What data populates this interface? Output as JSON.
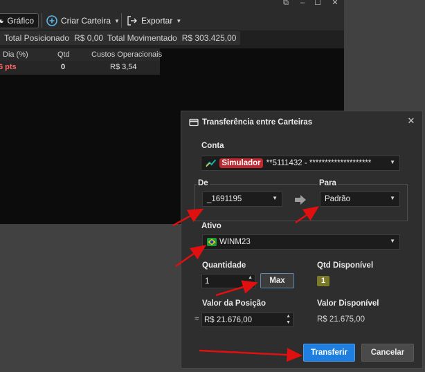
{
  "window": {
    "controls": [
      "⧉",
      "–",
      "☐",
      "✕"
    ]
  },
  "toolbar": {
    "chart_label": "Gráfico",
    "create_wallet_label": "Criar Carteira",
    "export_label": "Exportar"
  },
  "stats": {
    "total_posicionado_label": "Total Posicionado",
    "total_posicionado_value": "R$ 0,00",
    "total_movimentado_label": "Total Movimentado",
    "total_movimentado_value": "R$ 303.425,00"
  },
  "table": {
    "columns": [
      "Dia (%)",
      "Qtd",
      "Custos Operacionais"
    ],
    "row": {
      "dia": "6 pts",
      "qtd": "0",
      "custos": "R$ 3,54"
    }
  },
  "dialog": {
    "title": "Transferência entre Carteiras",
    "conta": {
      "label": "Conta",
      "badge": "Simulador",
      "value": "**5111432 - ********************"
    },
    "de": {
      "label": "De",
      "value": "_1691195"
    },
    "para": {
      "label": "Para",
      "value": "Padrão"
    },
    "ativo": {
      "label": "Ativo",
      "value": "WINM23"
    },
    "quantidade": {
      "label": "Quantidade",
      "value": "1",
      "max_label": "Max"
    },
    "qtd_disponivel": {
      "label": "Qtd Disponível",
      "value": "1"
    },
    "valor_posicao": {
      "label": "Valor da Posição",
      "approx": "≈",
      "value": "R$ 21.676,00"
    },
    "valor_disponivel": {
      "label": "Valor Disponível",
      "value": "R$ 21.675,00"
    },
    "transfer_label": "Transferir",
    "cancel_label": "Cancelar"
  },
  "colors": {
    "accent_blue": "#1e7fe0",
    "badge_red": "#c0282f",
    "qty_badge": "#7a7a2a",
    "negative_text": "#ff6666",
    "annotation_arrow": "#e01010"
  }
}
